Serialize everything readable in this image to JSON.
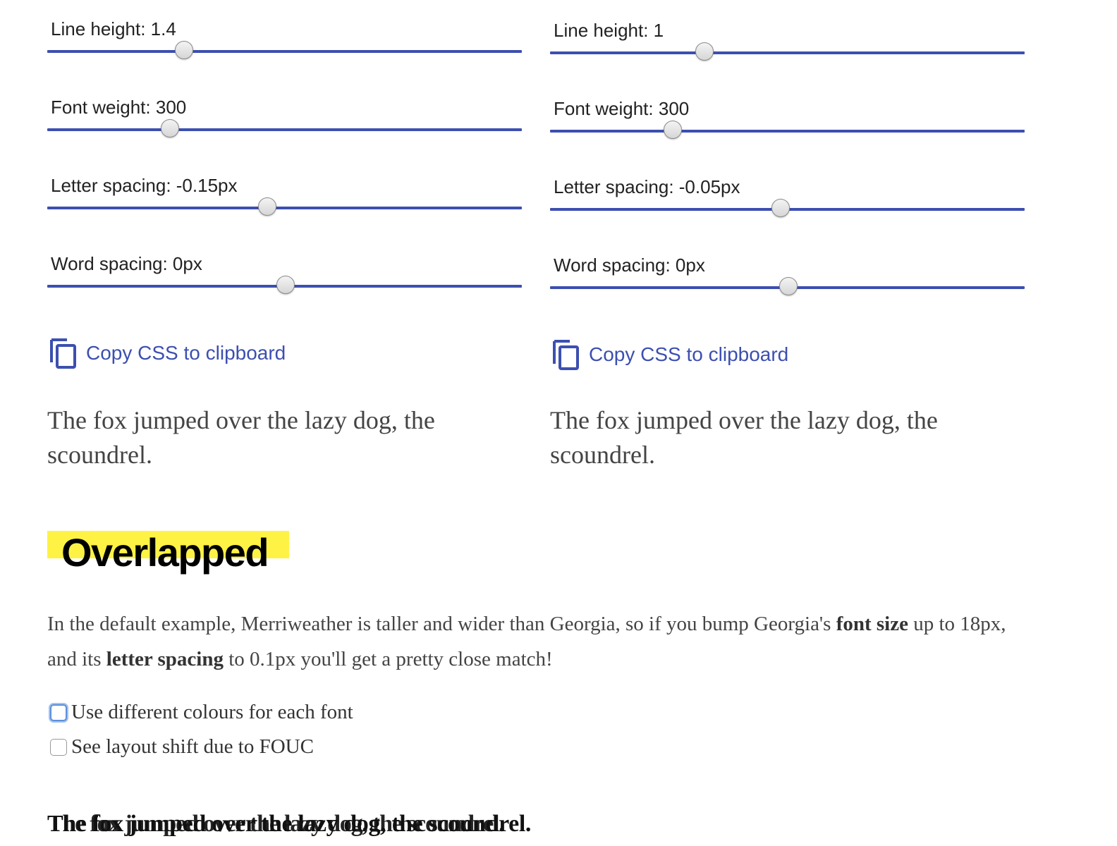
{
  "left": {
    "sliders": [
      {
        "label": "Line height: 1.4",
        "value": 0.29
      },
      {
        "label": "Font weight: 300",
        "value": 0.26
      },
      {
        "label": "Letter spacing: -0.15px",
        "value": 0.465
      },
      {
        "label": "Word spacing: 0px",
        "value": 0.503
      }
    ],
    "copy_label": "Copy CSS to clipboard",
    "sample_text": "The fox jumped over the lazy dog, the scoundrel."
  },
  "right": {
    "sliders": [
      {
        "label": "Line height: 1",
        "value": 0.327
      },
      {
        "label": "Font weight: 300",
        "value": 0.26
      },
      {
        "label": "Letter spacing: -0.05px",
        "value": 0.488
      },
      {
        "label": "Word spacing: 0px",
        "value": 0.503
      }
    ],
    "copy_label": "Copy CSS to clipboard",
    "sample_text": "The fox jumped over the lazy dog, the scoundrel."
  },
  "section": {
    "heading": "Overlapped",
    "para_1": "In the default example, Merriweather is taller and wider than Georgia, so if you bump Georgia's ",
    "para_bold_1": "font size",
    "para_2": " up to 18px, and its ",
    "para_bold_2": "letter spacing",
    "para_3": " to 0.1px you'll get a pretty close match!",
    "checkbox_colours": "Use different colours for each font",
    "checkbox_fouc": "See layout shift due to FOUC",
    "overlap_text": "The fox jumped over the lazy dog, the scoundrel."
  },
  "colors": {
    "accent": "#3c4fb0",
    "highlight": "#fef245",
    "text": "#444444"
  },
  "icons": {
    "copy": "copy-icon"
  }
}
